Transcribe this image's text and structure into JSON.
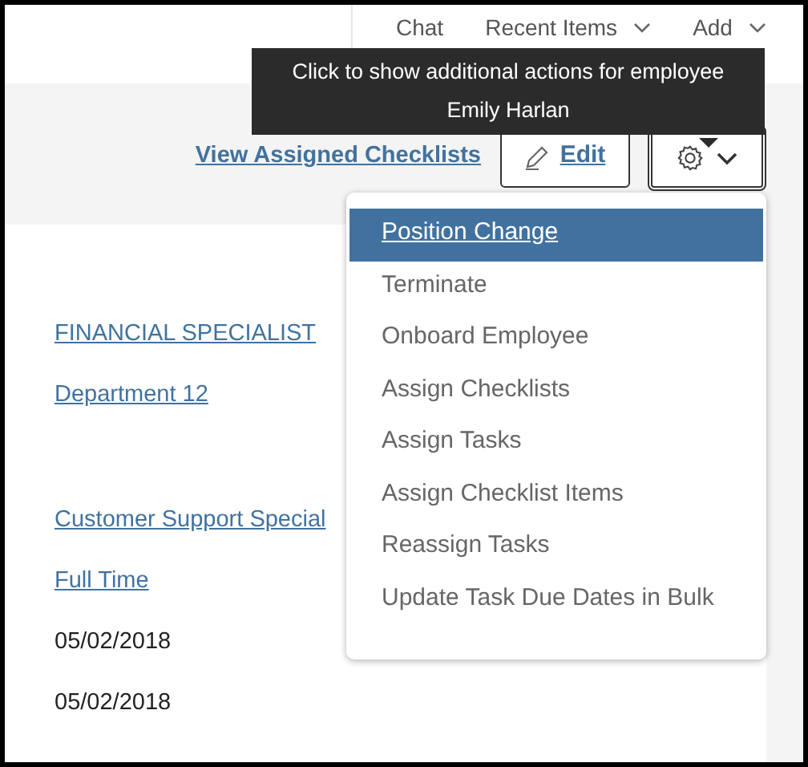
{
  "top_nav": [
    {
      "label": "Chat",
      "dropdown": false
    },
    {
      "label": "Recent Items",
      "dropdown": true
    },
    {
      "label": "Add",
      "dropdown": true
    }
  ],
  "tooltip": {
    "lines": [
      "Click to show additional actions for employee",
      "Emily Harlan"
    ]
  },
  "actions": {
    "link": "View Assigned Checklists",
    "edit_button": "Edit",
    "menu_expanded": true
  },
  "menu": [
    {
      "label": "Position Change",
      "selected": true
    },
    {
      "label": "Terminate",
      "selected": false
    },
    {
      "label": "Onboard Employee",
      "selected": false
    },
    {
      "label": "Assign Checklists",
      "selected": false
    },
    {
      "label": "Assign Tasks",
      "selected": false
    },
    {
      "label": "Assign Checklist Items",
      "selected": false
    },
    {
      "label": "Reassign Tasks",
      "selected": false
    },
    {
      "label": "Update Task Due Dates in Bulk",
      "selected": false
    }
  ],
  "field_groups": [
    [
      {
        "value": "FINANCIAL SPECIALIST",
        "kind": "link"
      },
      {
        "value": "Department 12",
        "kind": "link"
      }
    ],
    [
      {
        "value": "Customer Support Special",
        "kind": "link"
      },
      {
        "value": "Full Time",
        "kind": "link"
      },
      {
        "value": "05/02/2018",
        "kind": "text"
      },
      {
        "value": "05/02/2018",
        "kind": "text"
      }
    ]
  ]
}
